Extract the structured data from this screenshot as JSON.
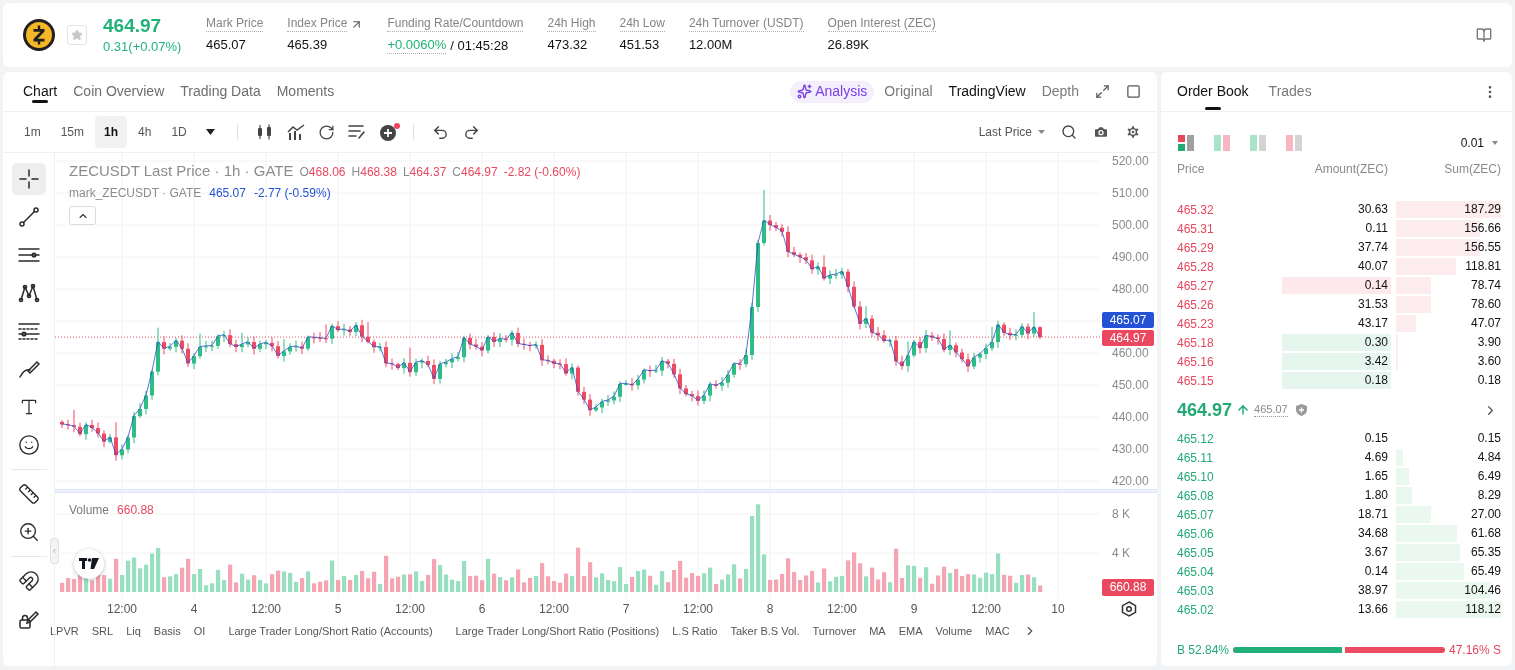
{
  "header": {
    "last_price": "464.97",
    "change": "0.31(+0.07%)",
    "stats": [
      {
        "label": "Mark Price",
        "value": "465.07",
        "kind": "plain"
      },
      {
        "label": "Index Price",
        "value": "465.39",
        "kind": "link"
      },
      {
        "label": "Funding Rate/Countdown",
        "value": "+0.0060%",
        "countdown": "/ 01:45:28",
        "kind": "funding"
      },
      {
        "label": "24h High",
        "value": "473.32",
        "kind": "plain"
      },
      {
        "label": "24h Low",
        "value": "451.53",
        "kind": "plain"
      },
      {
        "label": "24h Turnover (USDT)",
        "value": "12.00M",
        "kind": "plain"
      },
      {
        "label": "Open Interest (ZEC)",
        "value": "26.89K",
        "kind": "plain"
      }
    ]
  },
  "chart_panel": {
    "tabs": [
      {
        "label": "Chart",
        "selected": true
      },
      {
        "label": "Coin Overview",
        "selected": false
      },
      {
        "label": "Trading Data",
        "selected": false
      },
      {
        "label": "Moments",
        "selected": false
      }
    ],
    "views": [
      {
        "label": "Analysis",
        "kind": "ai",
        "selected": false
      },
      {
        "label": "Original",
        "kind": "plain",
        "selected": false
      },
      {
        "label": "TradingView",
        "kind": "plain",
        "selected": true
      },
      {
        "label": "Depth",
        "kind": "plain",
        "selected": false
      }
    ],
    "intervals": [
      {
        "label": "1m",
        "selected": false
      },
      {
        "label": "15m",
        "selected": false
      },
      {
        "label": "1h",
        "selected": true
      },
      {
        "label": "4h",
        "selected": false
      },
      {
        "label": "1D",
        "selected": false
      }
    ],
    "price_source": "Last Price",
    "tools": [
      {
        "kind": "crosshair",
        "selected": true
      },
      {
        "kind": "trend-line",
        "selected": false
      },
      {
        "kind": "parallel-lines",
        "selected": false
      },
      {
        "kind": "pattern",
        "selected": false
      },
      {
        "kind": "levels",
        "selected": false
      },
      {
        "kind": "brush",
        "selected": false
      },
      {
        "kind": "text",
        "selected": false
      },
      {
        "kind": "emoji",
        "selected": false
      },
      {
        "kind": "ruler",
        "selected": false
      },
      {
        "kind": "zoom",
        "selected": false
      },
      {
        "kind": "magnet",
        "selected": false
      },
      {
        "kind": "pencil",
        "selected": false
      }
    ],
    "legend": {
      "title": "ZECUSDT Last Price · 1h · GATE",
      "ohlc": [
        {
          "key": "O",
          "value": "468.06"
        },
        {
          "key": "H",
          "value": "468.38"
        },
        {
          "key": "L",
          "value": "464.37"
        },
        {
          "key": "C",
          "value": "464.97"
        }
      ],
      "change": "-2.82 (-0.60%)"
    },
    "mark_legend": {
      "title": "mark_ZECUSDT · GATE",
      "value": "465.07",
      "change": "-2.77 (-0.59%)"
    },
    "price_axis": [
      "520.00",
      "510.00",
      "500.00",
      "490.00",
      "480.00",
      "460.00",
      "450.00",
      "440.00",
      "430.00",
      "420.00"
    ],
    "price_tags": {
      "mark": "465.07",
      "last": "464.97"
    },
    "volume": {
      "label": "Volume",
      "value": "660.88",
      "axis": [
        "8 K",
        "4 K"
      ],
      "tag": "660.88"
    },
    "time_axis": [
      "12:00",
      "4",
      "12:00",
      "5",
      "12:00",
      "6",
      "12:00",
      "7",
      "12:00",
      "8",
      "12:00",
      "9",
      "12:00",
      "10"
    ],
    "indicators": [
      "LPVR",
      "SRL",
      "Liq",
      "Basis",
      "OI",
      "Large Trader Long/Short Ratio (Accounts)",
      "Large Trader Long/Short Ratio (Positions)",
      "L.S Ratio",
      "Taker B.S Vol.",
      "Turnover",
      "MA",
      "EMA",
      "Volume",
      "MAC"
    ]
  },
  "order_book": {
    "tabs": [
      {
        "label": "Order Book",
        "selected": true
      },
      {
        "label": "Trades",
        "selected": false
      }
    ],
    "precision": "0.01",
    "columns": [
      "Price",
      "Amount(ZEC)",
      "Sum(ZEC)"
    ],
    "asks": [
      {
        "price": "465.32",
        "amount": "30.63",
        "sum": "187.29",
        "level": 1.0
      },
      {
        "price": "465.31",
        "amount": "0.11",
        "sum": "156.66",
        "level": 0.8
      },
      {
        "price": "465.29",
        "amount": "37.74",
        "sum": "156.55",
        "level": 0.8
      },
      {
        "price": "465.28",
        "amount": "40.07",
        "sum": "118.81",
        "level": 0.57
      },
      {
        "price": "465.27",
        "amount": "0.14",
        "sum": "78.74",
        "level": 0.33,
        "color": "#fde8eb"
      },
      {
        "price": "465.26",
        "amount": "31.53",
        "sum": "78.60",
        "level": 0.33
      },
      {
        "price": "465.23",
        "amount": "43.17",
        "sum": "47.07",
        "level": 0.19
      },
      {
        "price": "465.18",
        "amount": "0.30",
        "sum": "3.90",
        "level": 0.02,
        "color": "#e6f5ee"
      },
      {
        "price": "465.16",
        "amount": "3.42",
        "sum": "3.60",
        "level": 0.02,
        "color": "#e6f5ee"
      },
      {
        "price": "465.15",
        "amount": "0.18",
        "sum": "0.18",
        "color": "#e6f5ee"
      }
    ],
    "last_price": "464.97",
    "mark_price": "465.07",
    "bids": [
      {
        "price": "465.12",
        "amount": "0.15",
        "sum": "0.15"
      },
      {
        "price": "465.11",
        "amount": "4.69",
        "sum": "4.84",
        "level": 0.07
      },
      {
        "price": "465.10",
        "amount": "1.65",
        "sum": "6.49",
        "level": 0.12
      },
      {
        "price": "465.08",
        "amount": "1.80",
        "sum": "8.29",
        "level": 0.15
      },
      {
        "price": "465.07",
        "amount": "18.71",
        "sum": "27.00",
        "level": 0.33
      },
      {
        "price": "465.06",
        "amount": "34.68",
        "sum": "61.68",
        "level": 0.58
      },
      {
        "price": "465.05",
        "amount": "3.67",
        "sum": "65.35",
        "level": 0.61
      },
      {
        "price": "465.04",
        "amount": "0.14",
        "sum": "65.49",
        "level": 0.65
      },
      {
        "price": "465.03",
        "amount": "38.97",
        "sum": "104.46",
        "level": 0.9
      },
      {
        "price": "465.02",
        "amount": "13.66",
        "sum": "118.12",
        "level": 1.0
      }
    ],
    "buy_ratio": "B 52.84%",
    "sell_ratio": "47.16% S",
    "level": 0.5284
  }
}
